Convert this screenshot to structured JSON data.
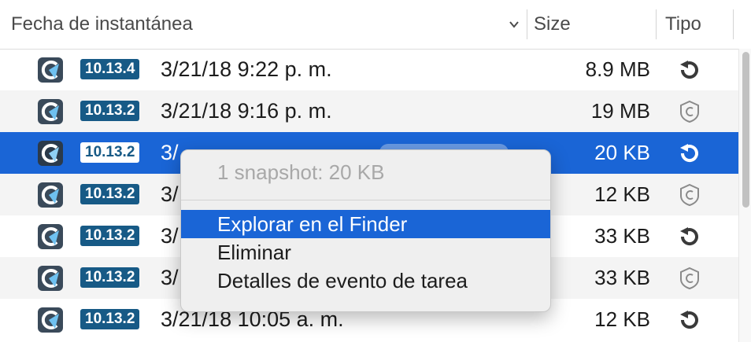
{
  "header": {
    "date_col": "Fecha de instantánea",
    "size_col": "Size",
    "type_col": "Tipo"
  },
  "colors": {
    "selection": "#1a65d6",
    "badge": "#175a86"
  },
  "rows": [
    {
      "version": "10.13.4",
      "date": "3/21/18 9:22 p. m.",
      "size": "8.9 MB",
      "type_icon": "restore-icon"
    },
    {
      "version": "10.13.2",
      "date": "3/21/18 9:16 p. m.",
      "size": "19 MB",
      "type_icon": "shield-icon"
    },
    {
      "version": "10.13.2",
      "date": "3/",
      "size": "20 KB",
      "type_icon": "restore-icon",
      "selected": true
    },
    {
      "version": "10.13.2",
      "date": "3/",
      "size": "12 KB",
      "type_icon": "shield-icon"
    },
    {
      "version": "10.13.2",
      "date": "3/",
      "size": "33 KB",
      "type_icon": "restore-icon"
    },
    {
      "version": "10.13.2",
      "date": "3/",
      "size": "33 KB",
      "type_icon": "shield-icon"
    },
    {
      "version": "10.13.2",
      "date": "3/21/18 10:05 a. m.",
      "size": "12 KB",
      "type_icon": "restore-icon"
    }
  ],
  "context_menu": {
    "info": "1 snapshot: 20 KB",
    "items": [
      "Explorar en el Finder",
      "Eliminar",
      "Detalles de evento de tarea"
    ],
    "highlighted": "Explorar en el Finder"
  }
}
